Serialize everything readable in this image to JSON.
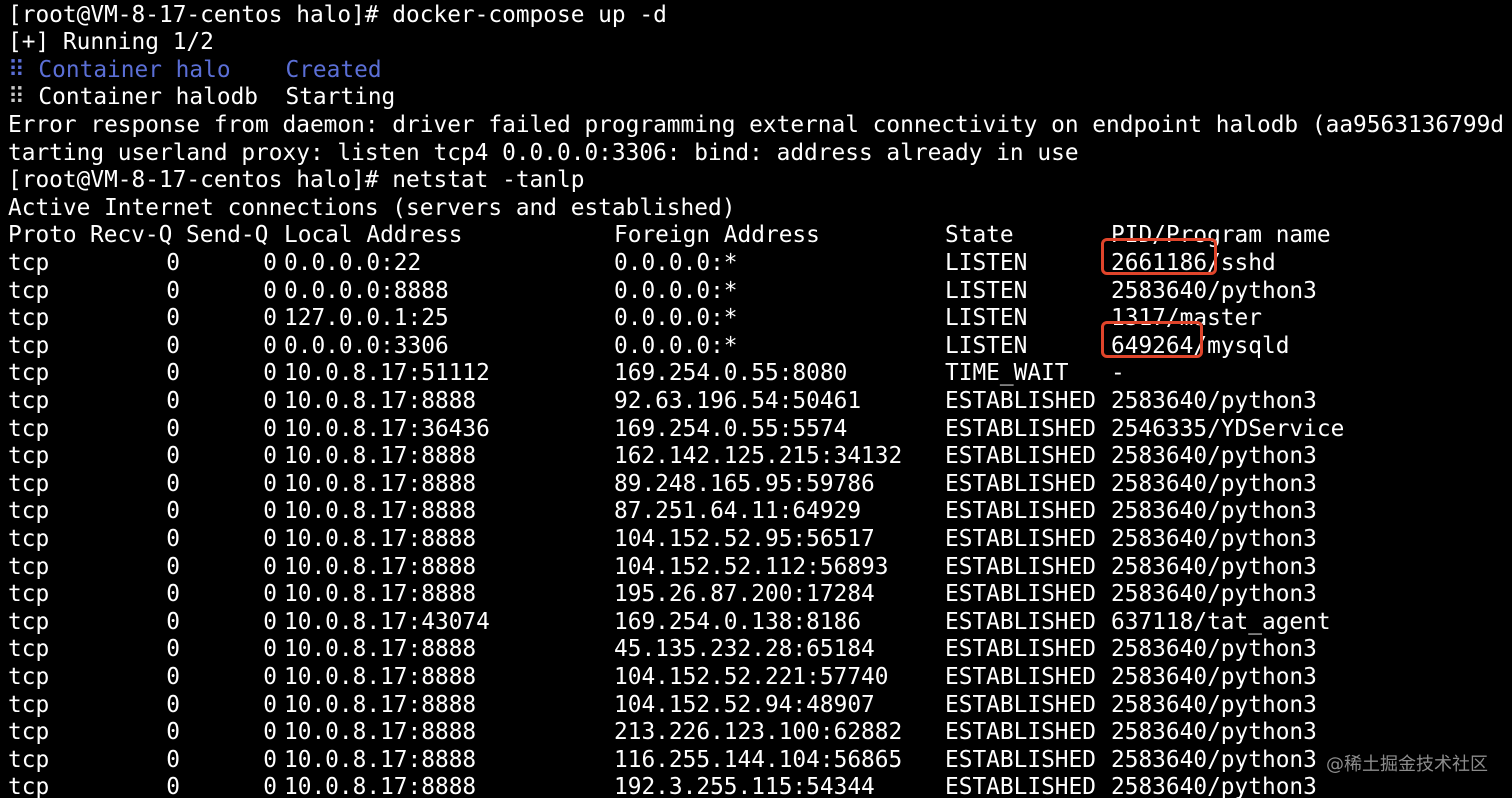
{
  "terminal": {
    "prompt_1": "[root@VM-8-17-centos halo]# docker-compose up -d",
    "running": "[+] Running 1/2",
    "containers": [
      {
        "spinner": "⠿",
        "text": " Container halo    ",
        "status": "Created",
        "style": "dim"
      },
      {
        "spinner": "⠿",
        "text": " Container halodb  ",
        "status": "Starting",
        "style": "normal"
      }
    ],
    "error_line_1": "Error response from daemon: driver failed programming external connectivity on endpoint halodb (aa9563136799d",
    "error_line_2": "tarting userland proxy: listen tcp4 0.0.0.0:3306: bind: address already in use",
    "prompt_2": "[root@VM-8-17-centos halo]# netstat -tanlp",
    "active_header": "Active Internet connections (servers and established)"
  },
  "netstat": {
    "columns": [
      "Proto",
      "Recv-Q",
      "Send-Q",
      "Local Address",
      "Foreign Address",
      "State",
      "PID/Program name"
    ],
    "rows": [
      {
        "proto": "tcp",
        "recvq": "0",
        "sendq": "0",
        "local": "0.0.0.0:22",
        "foreign": "0.0.0.0:*",
        "state": "LISTEN",
        "pid": "2661186",
        "program": "/sshd",
        "highlighted": true
      },
      {
        "proto": "tcp",
        "recvq": "0",
        "sendq": "0",
        "local": "0.0.0.0:8888",
        "foreign": "0.0.0.0:*",
        "state": "LISTEN",
        "pid": "2583640",
        "program": "/python3",
        "highlighted": false
      },
      {
        "proto": "tcp",
        "recvq": "0",
        "sendq": "0",
        "local": "127.0.0.1:25",
        "foreign": "0.0.0.0:*",
        "state": "LISTEN",
        "pid": "1317",
        "program": "/master",
        "highlighted": false
      },
      {
        "proto": "tcp",
        "recvq": "0",
        "sendq": "0",
        "local": "0.0.0.0:3306",
        "foreign": "0.0.0.0:*",
        "state": "LISTEN",
        "pid": "649264",
        "program": "/mysqld",
        "highlighted": true
      },
      {
        "proto": "tcp",
        "recvq": "0",
        "sendq": "0",
        "local": "10.0.8.17:51112",
        "foreign": "169.254.0.55:8080",
        "state": "TIME_WAIT",
        "pid": "-",
        "program": "",
        "highlighted": false
      },
      {
        "proto": "tcp",
        "recvq": "0",
        "sendq": "0",
        "local": "10.0.8.17:8888",
        "foreign": "92.63.196.54:50461",
        "state": "ESTABLISHED",
        "pid": "2583640",
        "program": "/python3",
        "highlighted": false
      },
      {
        "proto": "tcp",
        "recvq": "0",
        "sendq": "0",
        "local": "10.0.8.17:36436",
        "foreign": "169.254.0.55:5574",
        "state": "ESTABLISHED",
        "pid": "2546335",
        "program": "/YDService",
        "highlighted": false
      },
      {
        "proto": "tcp",
        "recvq": "0",
        "sendq": "0",
        "local": "10.0.8.17:8888",
        "foreign": "162.142.125.215:34132",
        "state": "ESTABLISHED",
        "pid": "2583640",
        "program": "/python3",
        "highlighted": false
      },
      {
        "proto": "tcp",
        "recvq": "0",
        "sendq": "0",
        "local": "10.0.8.17:8888",
        "foreign": "89.248.165.95:59786",
        "state": "ESTABLISHED",
        "pid": "2583640",
        "program": "/python3",
        "highlighted": false
      },
      {
        "proto": "tcp",
        "recvq": "0",
        "sendq": "0",
        "local": "10.0.8.17:8888",
        "foreign": "87.251.64.11:64929",
        "state": "ESTABLISHED",
        "pid": "2583640",
        "program": "/python3",
        "highlighted": false
      },
      {
        "proto": "tcp",
        "recvq": "0",
        "sendq": "0",
        "local": "10.0.8.17:8888",
        "foreign": "104.152.52.95:56517",
        "state": "ESTABLISHED",
        "pid": "2583640",
        "program": "/python3",
        "highlighted": false
      },
      {
        "proto": "tcp",
        "recvq": "0",
        "sendq": "0",
        "local": "10.0.8.17:8888",
        "foreign": "104.152.52.112:56893",
        "state": "ESTABLISHED",
        "pid": "2583640",
        "program": "/python3",
        "highlighted": false
      },
      {
        "proto": "tcp",
        "recvq": "0",
        "sendq": "0",
        "local": "10.0.8.17:8888",
        "foreign": "195.26.87.200:17284",
        "state": "ESTABLISHED",
        "pid": "2583640",
        "program": "/python3",
        "highlighted": false
      },
      {
        "proto": "tcp",
        "recvq": "0",
        "sendq": "0",
        "local": "10.0.8.17:43074",
        "foreign": "169.254.0.138:8186",
        "state": "ESTABLISHED",
        "pid": "637118",
        "program": "/tat_agent",
        "highlighted": false
      },
      {
        "proto": "tcp",
        "recvq": "0",
        "sendq": "0",
        "local": "10.0.8.17:8888",
        "foreign": "45.135.232.28:65184",
        "state": "ESTABLISHED",
        "pid": "2583640",
        "program": "/python3",
        "highlighted": false
      },
      {
        "proto": "tcp",
        "recvq": "0",
        "sendq": "0",
        "local": "10.0.8.17:8888",
        "foreign": "104.152.52.221:57740",
        "state": "ESTABLISHED",
        "pid": "2583640",
        "program": "/python3",
        "highlighted": false
      },
      {
        "proto": "tcp",
        "recvq": "0",
        "sendq": "0",
        "local": "10.0.8.17:8888",
        "foreign": "104.152.52.94:48907",
        "state": "ESTABLISHED",
        "pid": "2583640",
        "program": "/python3",
        "highlighted": false
      },
      {
        "proto": "tcp",
        "recvq": "0",
        "sendq": "0",
        "local": "10.0.8.17:8888",
        "foreign": "213.226.123.100:62882",
        "state": "ESTABLISHED",
        "pid": "2583640",
        "program": "/python3",
        "highlighted": false
      },
      {
        "proto": "tcp",
        "recvq": "0",
        "sendq": "0",
        "local": "10.0.8.17:8888",
        "foreign": "116.255.144.104:56865",
        "state": "ESTABLISHED",
        "pid": "2583640",
        "program": "/python3",
        "highlighted": false
      },
      {
        "proto": "tcp",
        "recvq": "0",
        "sendq": "0",
        "local": "10.0.8.17:8888",
        "foreign": "192.3.255.115:54344",
        "state": "ESTABLISHED",
        "pid": "2583640",
        "program": "/python3",
        "highlighted": false
      }
    ]
  },
  "colors": {
    "background": "#000000",
    "text": "#ffffff",
    "dim_text": "#5b6fd6",
    "highlight_box": "#e0452b",
    "watermark": "#8c8c8c"
  },
  "watermark": "@稀土掘金技术社区"
}
